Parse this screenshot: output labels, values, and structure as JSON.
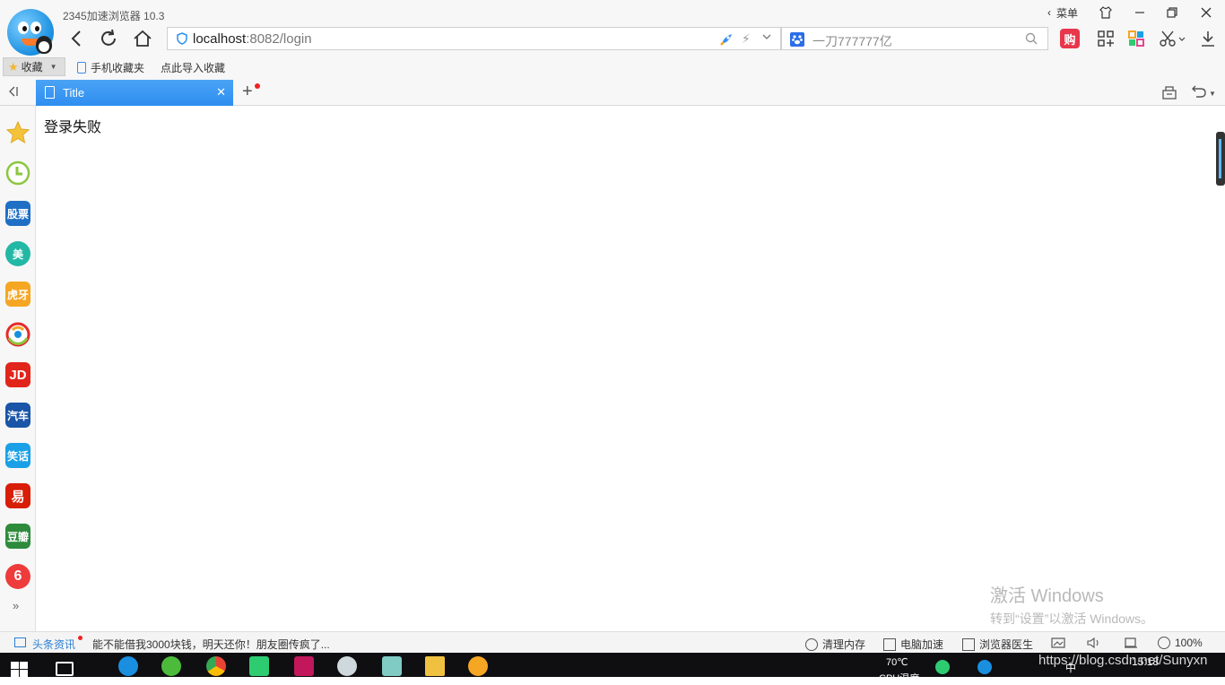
{
  "window": {
    "title": "2345加速浏览器 10.3",
    "menu_label": "菜单"
  },
  "toolbar": {
    "url_host": "localhost",
    "url_rest": ":8082/login",
    "search_placeholder": "一刀777777亿",
    "shop_label": "购"
  },
  "bookmarks": {
    "favorites_label": "收藏",
    "items": [
      {
        "label": "手机收藏夹"
      },
      {
        "label": "点此导入收藏"
      }
    ]
  },
  "tabs": [
    {
      "title": "Title",
      "active": true
    }
  ],
  "sidebar": {
    "items": [
      {
        "label": "",
        "icon": "star-icon",
        "color": "#f5c33b"
      },
      {
        "label": "",
        "icon": "clock-icon",
        "color": "#8cc63f"
      },
      {
        "label": "股票",
        "icon": "stock-icon",
        "color": "#1f6fc5"
      },
      {
        "label": "美",
        "icon": "meituan-icon",
        "color": "#23b8a5"
      },
      {
        "label": "虎牙",
        "icon": "huya-icon",
        "color": "#f5a623"
      },
      {
        "label": "",
        "icon": "sina-icon",
        "color": "#e6292b"
      },
      {
        "label": "JD",
        "icon": "jd-icon",
        "color": "#e1251b"
      },
      {
        "label": "汽车",
        "icon": "car-icon",
        "color": "#1a55a7"
      },
      {
        "label": "笑话",
        "icon": "joke-icon",
        "color": "#1aa0e6"
      },
      {
        "label": "易",
        "icon": "netease-icon",
        "color": "#d81e06"
      },
      {
        "label": "豆瓣",
        "icon": "douban-icon",
        "color": "#2e8b3c"
      },
      {
        "label": "6",
        "icon": "video-icon",
        "color": "#ee3b3b"
      }
    ]
  },
  "content": {
    "message": "登录失败"
  },
  "watermark": {
    "title": "激活 Windows",
    "subtitle": "转到“设置”以激活 Windows。"
  },
  "status_bar": {
    "news_label": "头条资讯",
    "news_headline": "能不能借我3000块钱，明天还你！朋友圈传疯了...",
    "clean_memory": "清理内存",
    "pc_speedup": "电脑加速",
    "browser_doctor": "浏览器医生",
    "zoom": "100%"
  },
  "taskbar": {
    "temperature": "70℃",
    "temperature_sub": "CPU温度",
    "ime": "中",
    "time": "15:18",
    "blog_url": "https://blog.csdn.net/Sunyxn"
  }
}
